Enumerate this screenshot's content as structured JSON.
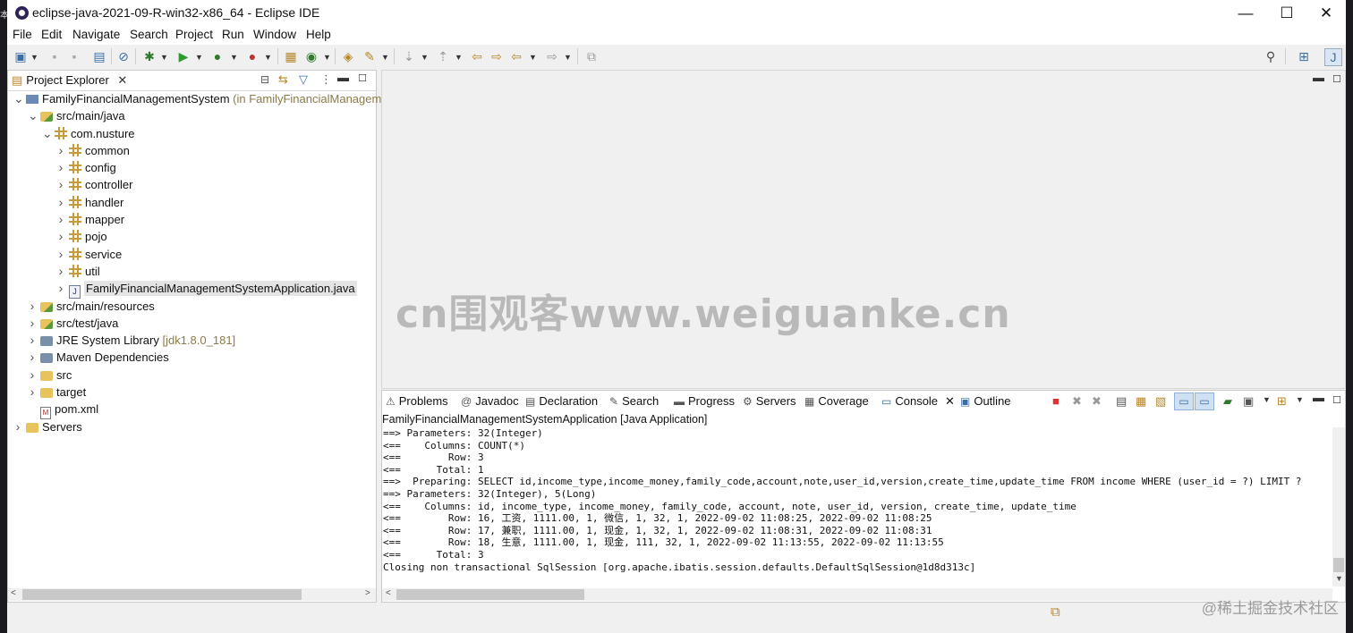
{
  "window": {
    "title": "eclipse-java-2021-09-R-win32-x86_64 - Eclipse IDE",
    "minimize": "—",
    "maximize": "☐",
    "close": "✕"
  },
  "menu": [
    "File",
    "Edit",
    "Navigate",
    "Search",
    "Project",
    "Run",
    "Window",
    "Help"
  ],
  "project_explorer": {
    "tab_label": "Project Explorer",
    "tree": [
      {
        "label": "FamilyFinancialManagementSystem",
        "suffix": " (in FamilyFinancialManagement",
        "depth": 0,
        "toggle": "v",
        "icon": "proj"
      },
      {
        "label": "src/main/java",
        "depth": 1,
        "toggle": "v",
        "icon": "srcf"
      },
      {
        "label": "com.nusture",
        "depth": 2,
        "toggle": "v",
        "icon": "pkg"
      },
      {
        "label": "common",
        "depth": 3,
        "toggle": ">",
        "icon": "pkg"
      },
      {
        "label": "config",
        "depth": 3,
        "toggle": ">",
        "icon": "pkg"
      },
      {
        "label": "controller",
        "depth": 3,
        "toggle": ">",
        "icon": "pkg"
      },
      {
        "label": "handler",
        "depth": 3,
        "toggle": ">",
        "icon": "pkg"
      },
      {
        "label": "mapper",
        "depth": 3,
        "toggle": ">",
        "icon": "pkg"
      },
      {
        "label": "pojo",
        "depth": 3,
        "toggle": ">",
        "icon": "pkg"
      },
      {
        "label": "service",
        "depth": 3,
        "toggle": ">",
        "icon": "pkg"
      },
      {
        "label": "util",
        "depth": 3,
        "toggle": ">",
        "icon": "pkg"
      },
      {
        "label": "FamilyFinancialManagementSystemApplication.java",
        "depth": 3,
        "toggle": ">",
        "icon": "jfile",
        "selected": true
      },
      {
        "label": "src/main/resources",
        "depth": 1,
        "toggle": ">",
        "icon": "srcf"
      },
      {
        "label": "src/test/java",
        "depth": 1,
        "toggle": ">",
        "icon": "srcf"
      },
      {
        "label": "JRE System Library",
        "suffix": " [jdk1.8.0_181]",
        "depth": 1,
        "toggle": ">",
        "icon": "jar"
      },
      {
        "label": "Maven Dependencies",
        "depth": 1,
        "toggle": ">",
        "icon": "jar"
      },
      {
        "label": "src",
        "depth": 1,
        "toggle": ">",
        "icon": "folder"
      },
      {
        "label": "target",
        "depth": 1,
        "toggle": ">",
        "icon": "folder"
      },
      {
        "label": "pom.xml",
        "depth": 1,
        "toggle": "",
        "icon": "xml"
      },
      {
        "label": "Servers",
        "depth": 0,
        "toggle": ">",
        "icon": "folder"
      }
    ]
  },
  "bottom_tabs": [
    "Problems",
    "Javadoc",
    "Declaration",
    "Search",
    "Progress",
    "Servers",
    "Coverage",
    "Console",
    "Outline"
  ],
  "bottom_tab_icons": [
    "⚠",
    "@",
    "▤",
    "✎",
    "▬",
    "⚙",
    "▦",
    "▭",
    "▣"
  ],
  "console": {
    "process": "FamilyFinancialManagementSystemApplication [Java Application]",
    "lines": [
      "==> Parameters: 32(Integer)",
      "<==    Columns: COUNT(*)",
      "<==        Row: 3",
      "<==      Total: 1",
      "==>  Preparing: SELECT id,income_type,income_money,family_code,account,note,user_id,version,create_time,update_time FROM income WHERE (user_id = ?) LIMIT ?",
      "==> Parameters: 32(Integer), 5(Long)",
      "<==    Columns: id, income_type, income_money, family_code, account, note, user_id, version, create_time, update_time",
      "<==        Row: 16, 工资, 1111.00, 1, 微信, 1, 32, 1, 2022-09-02 11:08:25, 2022-09-02 11:08:25",
      "<==        Row: 17, 兼职, 1111.00, 1, 现金, 1, 32, 1, 2022-09-02 11:08:31, 2022-09-02 11:08:31",
      "<==        Row: 18, 生意, 1111.00, 1, 现金, 111, 32, 1, 2022-09-02 11:13:55, 2022-09-02 11:13:55",
      "<==      Total: 3",
      "Closing non transactional SqlSession [org.apache.ibatis.session.defaults.DefaultSqlSession@1d8d313c]"
    ]
  },
  "watermarks": {
    "center": "cn围观客www.weiguanke.cn",
    "corner": "@稀土掘金技术社区"
  },
  "left_edge_char": "本"
}
